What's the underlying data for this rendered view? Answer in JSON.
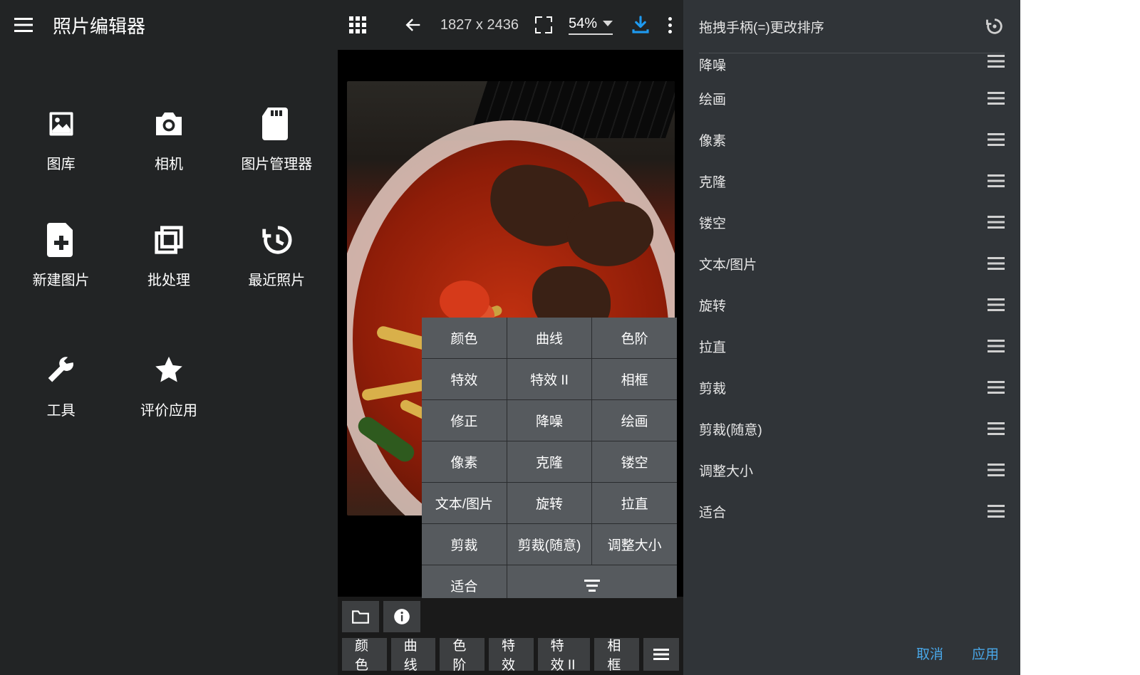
{
  "panel1": {
    "title": "照片编辑器",
    "items": {
      "gallery": "图库",
      "camera": "相机",
      "file_manager": "图片管理器",
      "new_image": "新建图片",
      "batch": "批处理",
      "recent": "最近照片",
      "tools": "工具",
      "rate": "评价应用"
    }
  },
  "panel2": {
    "dimensions": "1827 x 2436",
    "zoom": "54%",
    "pop": [
      "颜色",
      "曲线",
      "色阶",
      "特效",
      "特效 II",
      "相框",
      "修正",
      "降噪",
      "绘画",
      "像素",
      "克隆",
      "镂空",
      "文本/图片",
      "旋转",
      "拉直",
      "剪裁",
      "剪裁(随意)",
      "调整大小",
      "适合"
    ],
    "chips": [
      "颜色",
      "曲线",
      "色阶",
      "特效",
      "特效 II",
      "相框"
    ]
  },
  "panel3": {
    "title": "拖拽手柄(=)更改排序",
    "items": [
      "降噪",
      "绘画",
      "像素",
      "克隆",
      "镂空",
      "文本/图片",
      "旋转",
      "拉直",
      "剪裁",
      "剪裁(随意)",
      "调整大小",
      "适合"
    ],
    "cancel": "取消",
    "apply": "应用"
  }
}
